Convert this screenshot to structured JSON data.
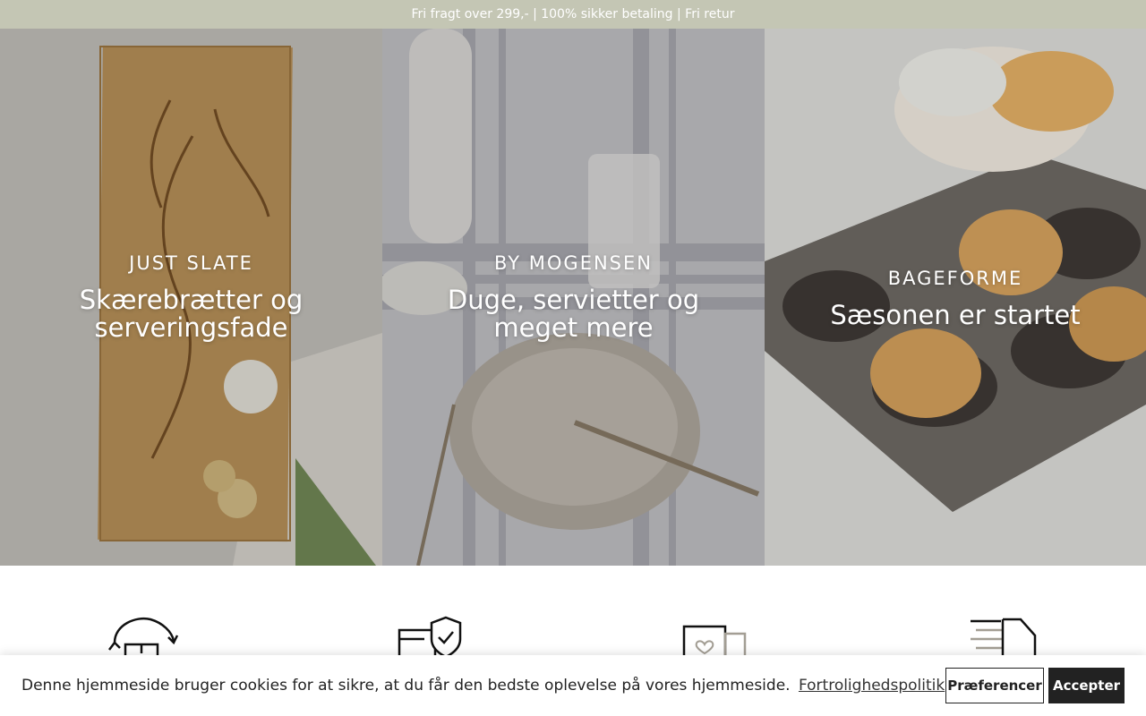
{
  "announcement": {
    "text": "Fri fragt over 299,- | 100% sikker betaling | Fri retur"
  },
  "collections": [
    {
      "kicker": "JUST SLATE",
      "title": "Skærebrætter og serveringsfade"
    },
    {
      "kicker": "BY MOGENSEN",
      "title": "Duge, servietter og meget mere"
    },
    {
      "kicker": "BAGEFORME",
      "title": "Sæsonen er startet"
    }
  ],
  "usp_icons": [
    "return-icon",
    "secure-payment-icon",
    "gift-card-icon",
    "delivery-truck-icon"
  ],
  "cookie_banner": {
    "message": "Denne hjemmeside bruger cookies for at sikre, at du får den bedste oplevelse på vores hjemmeside.",
    "policy_link": "Fortrolighedspolitik",
    "preferences_label": "Præferencer",
    "accept_label": "Accepter"
  },
  "colors": {
    "announcement_bg": "#c4c6b4",
    "button_dark": "#222222"
  }
}
